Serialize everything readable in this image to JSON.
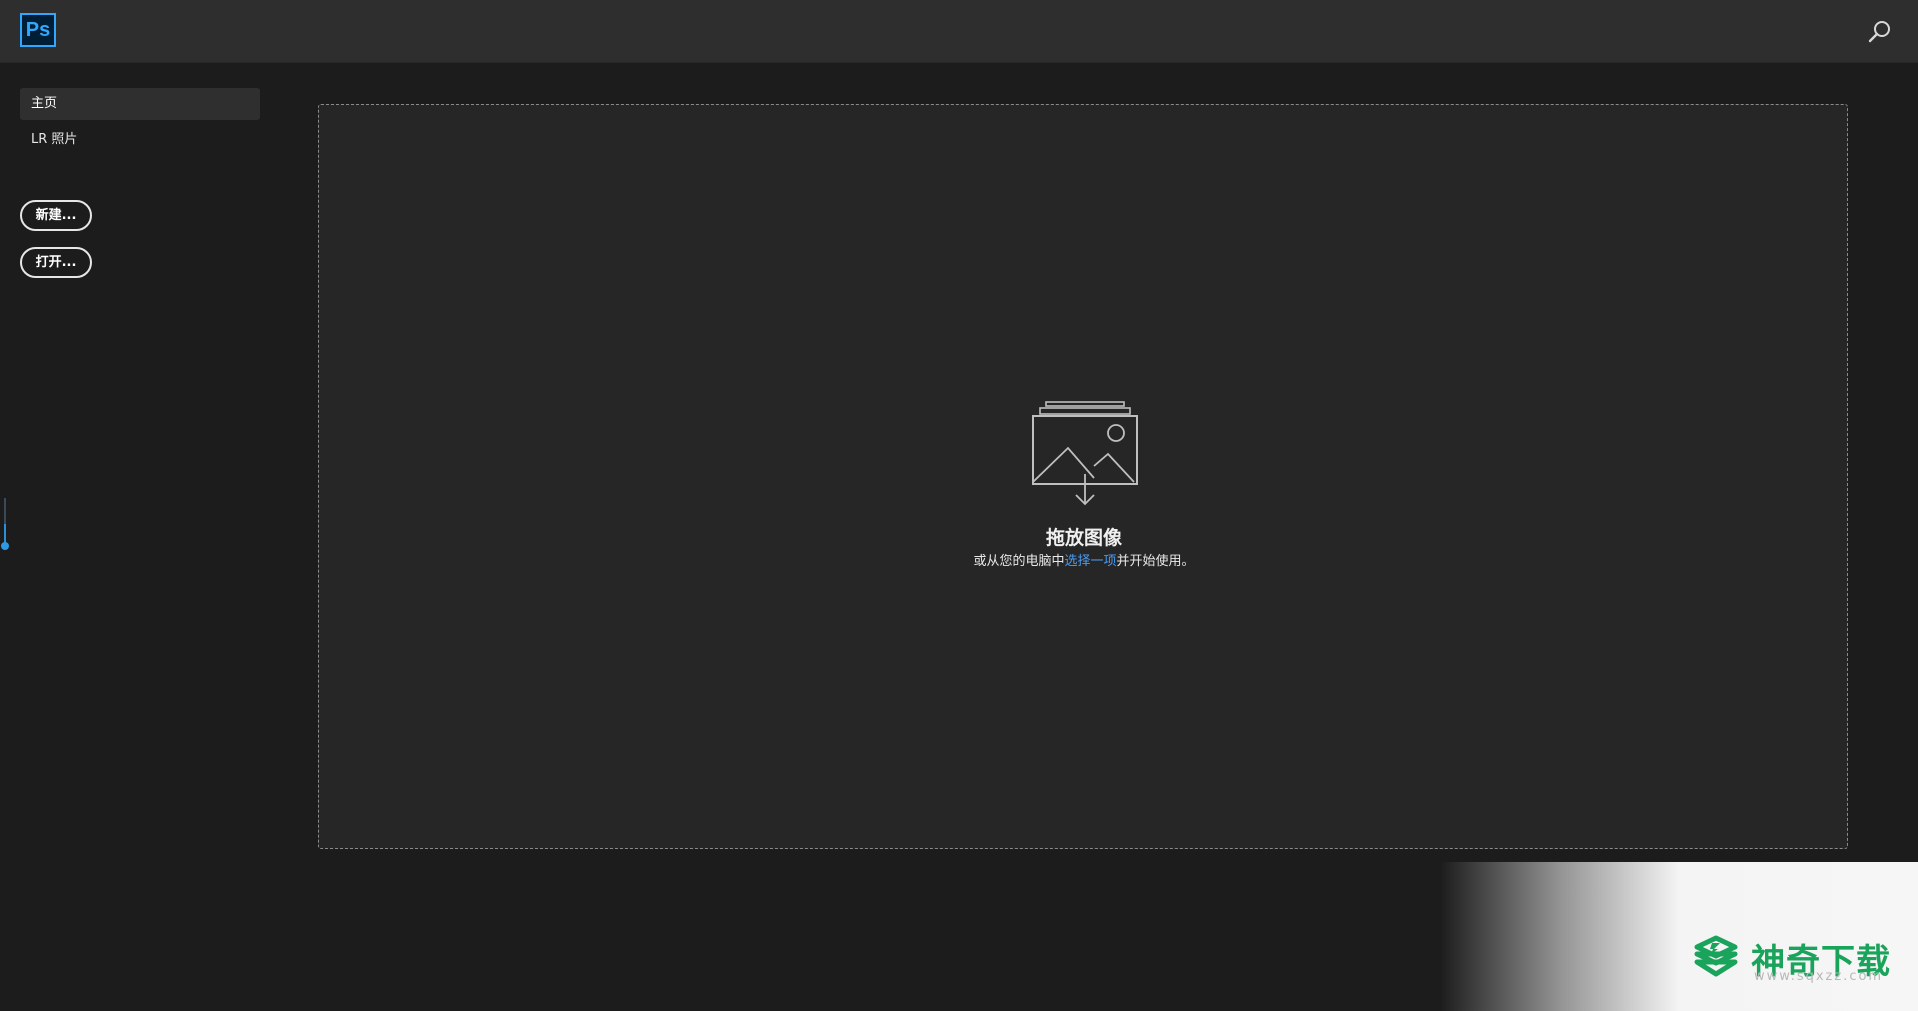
{
  "app": {
    "logo_text": "Ps",
    "accent_color": "#31a8ff",
    "search_icon": "search-icon"
  },
  "sidebar": {
    "items": [
      {
        "label": "主页",
        "active": true
      },
      {
        "label": "LR 照片",
        "active": false
      }
    ],
    "buttons": {
      "new_label": "新建...",
      "open_label": "打开..."
    }
  },
  "dropzone": {
    "icon": "image-stack-download-icon",
    "title": "拖放图像",
    "subtitle_prefix": "或从您的电脑中",
    "subtitle_link": "选择一项",
    "subtitle_suffix": "并开始使用。",
    "link_color": "#4a9cf2"
  },
  "watermark": {
    "title": "神奇下载",
    "url": "www.sqxzz.com",
    "color": "#1aa35b"
  }
}
